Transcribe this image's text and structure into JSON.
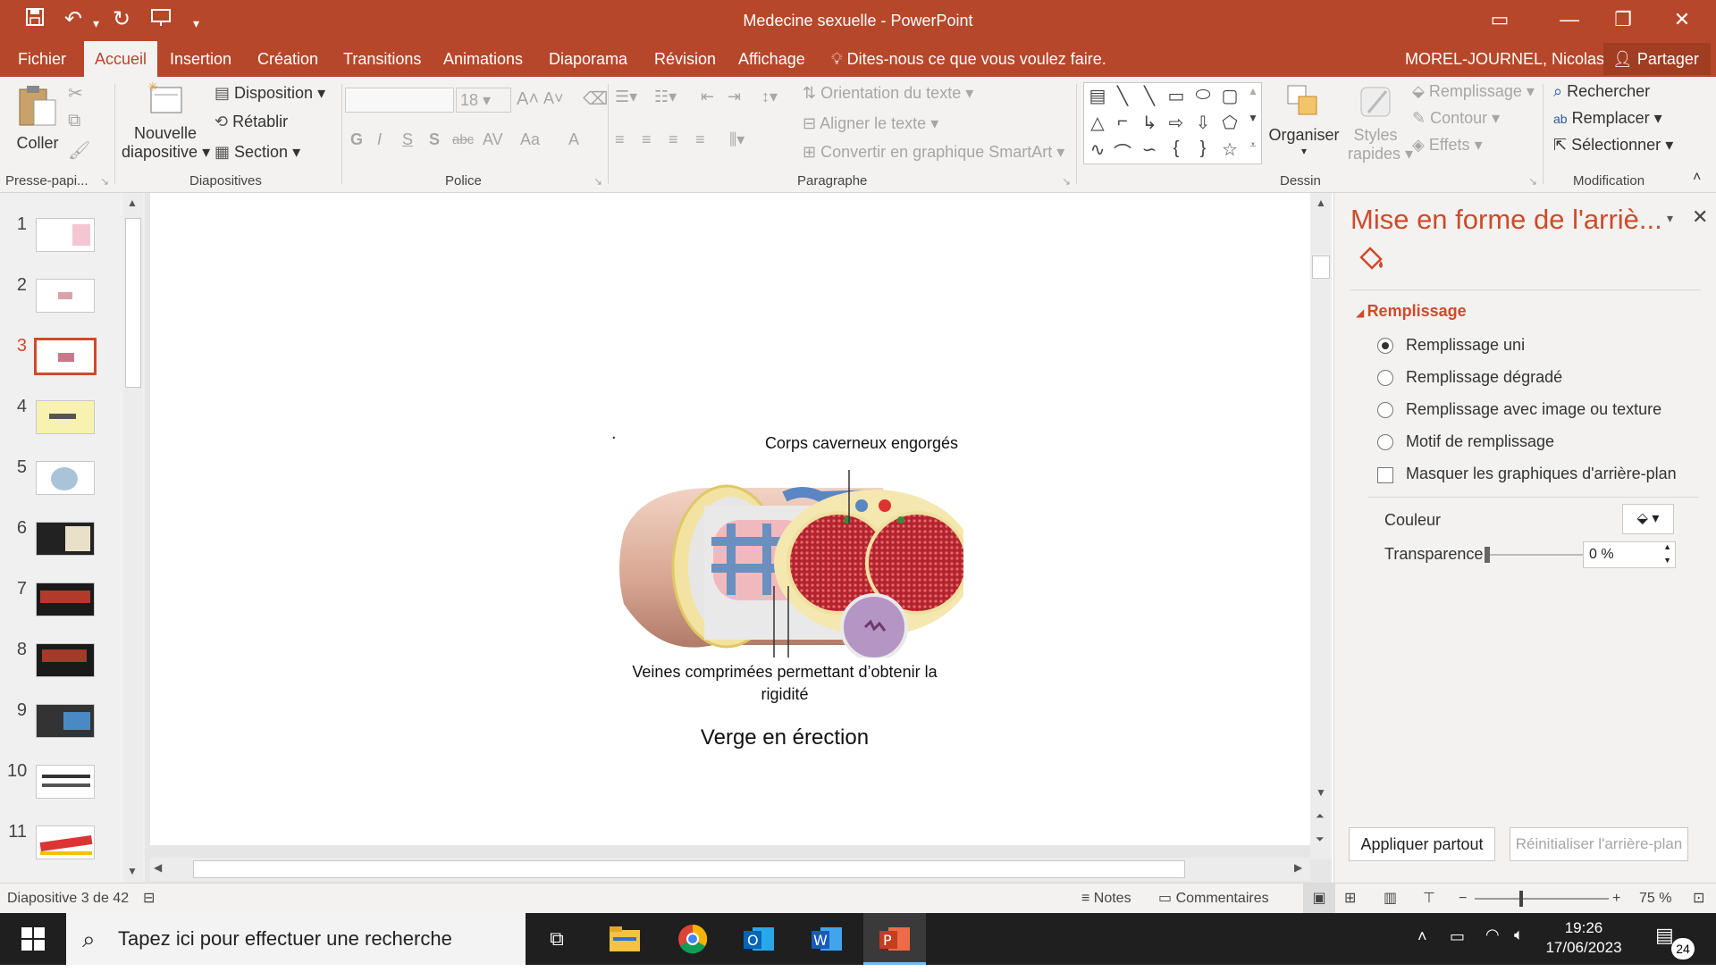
{
  "titlebar": {
    "title": "Medecine sexuelle - PowerPoint",
    "icons": [
      "save-icon",
      "undo-icon",
      "redo-icon",
      "start-from-beginning-icon",
      "customize-qat-icon"
    ]
  },
  "menu": {
    "items": [
      "Fichier",
      "Accueil",
      "Insertion",
      "Création",
      "Transitions",
      "Animations",
      "Diaporama",
      "Révision",
      "Affichage"
    ],
    "active": "Accueil",
    "tell_me": "Dites-nous ce que vous voulez faire.",
    "user": "MOREL-JOURNEL, Nicolas",
    "share": "Partager"
  },
  "ribbon": {
    "clipboard": {
      "paste": "Coller",
      "label": "Presse-papi..."
    },
    "slides": {
      "new_slide_1": "Nouvelle",
      "new_slide_2": "diapositive",
      "layout": "Disposition",
      "reset": "Rétablir",
      "section": "Section",
      "label": "Diapositives"
    },
    "font": {
      "font_name": "",
      "font_size": "18",
      "label": "Police",
      "bold": "G",
      "italic": "I",
      "underline": "S",
      "shadow": "S",
      "strike": "abc",
      "spacing": "AV",
      "case": "Aa",
      "color": "A"
    },
    "paragraph": {
      "text_direction": "Orientation du texte",
      "align_text": "Aligner le texte",
      "smartart": "Convertir en graphique SmartArt",
      "label": "Paragraphe"
    },
    "drawing": {
      "arrange": "Organiser",
      "quick_styles_1": "Styles",
      "quick_styles_2": "rapides",
      "fill": "Remplissage",
      "outline": "Contour",
      "effects": "Effets",
      "label": "Dessin"
    },
    "editing": {
      "find": "Rechercher",
      "replace": "Remplacer",
      "select": "Sélectionner",
      "label": "Modification"
    }
  },
  "thumbnails": [
    "1",
    "2",
    "3",
    "4",
    "5",
    "6",
    "7",
    "8",
    "9",
    "10",
    "11"
  ],
  "selected_slide": "3",
  "slide": {
    "dot": ".",
    "label_top": "Corps caverneux engorgés",
    "label_bottom_1": "Veines comprimées permettant d’obtenir la",
    "label_bottom_2": "rigidité",
    "caption": "Verge en érection"
  },
  "panel": {
    "title": "Mise en forme de l'arriè...",
    "section": "Remplissage",
    "options": [
      "Remplissage uni",
      "Remplissage dégradé",
      "Remplissage avec image ou texture",
      "Motif de remplissage"
    ],
    "selected_option": "Remplissage uni",
    "hide_graphics": "Masquer les graphiques d'arrière-plan",
    "hide_graphics_checked": false,
    "color_label": "Couleur",
    "transparency_label": "Transparence",
    "transparency_value": "0 %",
    "transparency_level": 0,
    "apply_all": "Appliquer partout",
    "reset_bg": "Réinitialiser l'arrière-plan"
  },
  "statusbar": {
    "slide_info": "Diapositive 3 de 42",
    "notes": "Notes",
    "comments": "Commentaires",
    "zoom": "75 %"
  },
  "taskbar": {
    "search": "Tapez ici pour effectuer une recherche",
    "time": "19:26",
    "date": "17/06/2023",
    "notifications": "24"
  },
  "colors": {
    "accent": "#b7472a",
    "panel_title": "#d04a29"
  }
}
